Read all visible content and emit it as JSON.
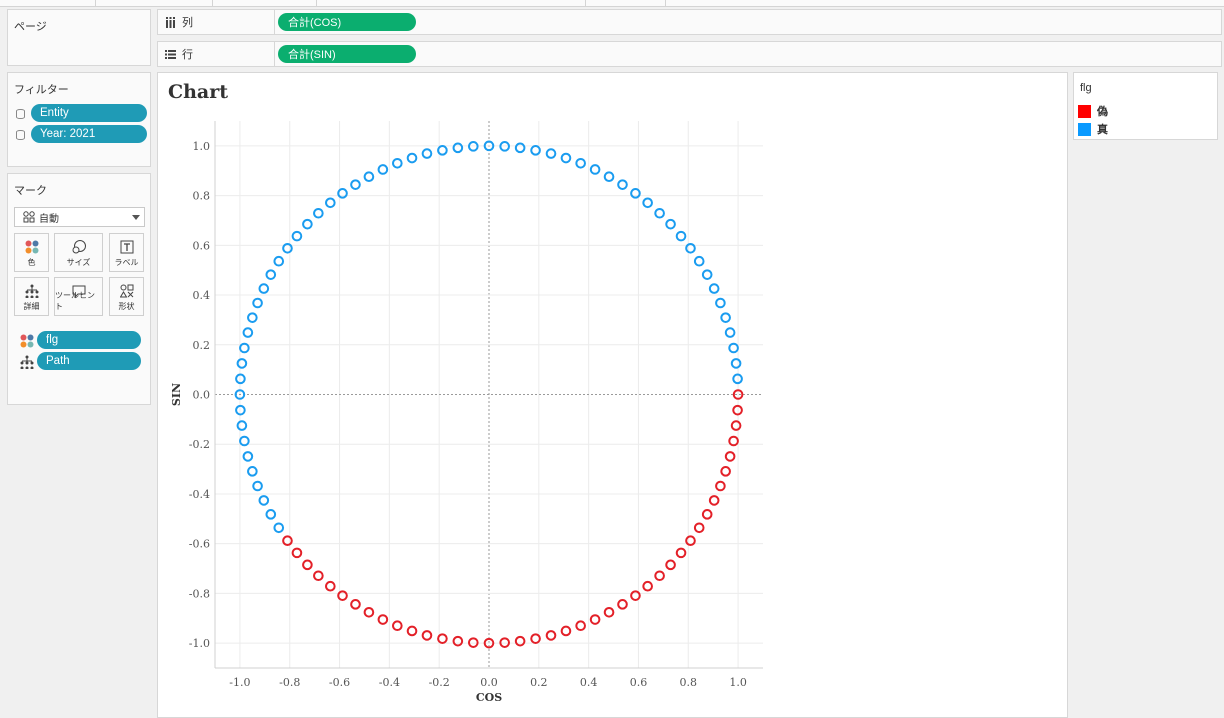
{
  "left_panel": {
    "pages_title": "ページ",
    "filters_title": "フィルター",
    "filters": [
      "Entity",
      "Year: 2021"
    ],
    "marks_title": "マーク",
    "mark_type": "自動",
    "mark_buttons": [
      "色",
      "サイズ",
      "ラベル",
      "詳細",
      "ツールヒント",
      "形状"
    ],
    "mark_fields": [
      "flg",
      "Path"
    ]
  },
  "shelves": {
    "columns_label": "列",
    "columns_pill": "合計(COS)",
    "rows_label": "行",
    "rows_pill": "合計(SIN)"
  },
  "legend": {
    "title": "flg",
    "items": [
      {
        "label": "偽",
        "color": "#ff0000"
      },
      {
        "label": "真",
        "color": "#0a9aff"
      }
    ]
  },
  "chart_data": {
    "type": "scatter",
    "title": "Chart",
    "xlabel": "COS",
    "ylabel": "SIN",
    "xlim": [
      -1.1,
      1.1
    ],
    "ylim": [
      -1.1,
      1.1
    ],
    "xticks": [
      "-1.0",
      "-0.8",
      "-0.6",
      "-0.4",
      "-0.2",
      "0.0",
      "0.2",
      "0.4",
      "0.6",
      "0.8",
      "1.0"
    ],
    "yticks": [
      "1.0",
      "0.8",
      "0.6",
      "0.4",
      "0.2",
      "0.0",
      "-0.2",
      "-0.4",
      "-0.6",
      "-0.8",
      "-1.0"
    ],
    "grid": true,
    "zero_lines": true,
    "marker": "open-circle",
    "series": [
      {
        "name": "偽",
        "color": "#e32028",
        "x": [
          1.0,
          0.998,
          0.992,
          0.982,
          0.968,
          0.95,
          0.929,
          0.904,
          0.876,
          0.844,
          0.809,
          0.771,
          0.729,
          0.685,
          0.637,
          0.588,
          0.536,
          0.482,
          0.426,
          0.368,
          0.309,
          0.249,
          0.187,
          0.125,
          0.063,
          0.0,
          -0.063,
          -0.125,
          -0.187,
          -0.249,
          -0.309,
          -0.368,
          -0.426,
          -0.482,
          -0.536,
          -0.588,
          -0.637,
          -0.685,
          -0.729,
          -0.771,
          -0.809
        ],
        "y": [
          -0.0,
          -0.063,
          -0.125,
          -0.187,
          -0.249,
          -0.309,
          -0.368,
          -0.426,
          -0.482,
          -0.536,
          -0.588,
          -0.637,
          -0.685,
          -0.729,
          -0.771,
          -0.809,
          -0.844,
          -0.876,
          -0.905,
          -0.93,
          -0.951,
          -0.969,
          -0.982,
          -0.992,
          -0.998,
          -1.0,
          -0.998,
          -0.992,
          -0.982,
          -0.969,
          -0.951,
          -0.93,
          -0.905,
          -0.876,
          -0.844,
          -0.809,
          -0.771,
          -0.729,
          -0.685,
          -0.637,
          -0.588
        ]
      },
      {
        "name": "真",
        "color": "#1a9cf0",
        "x": [
          -0.844,
          -0.876,
          -0.904,
          -0.929,
          -0.95,
          -0.968,
          -0.982,
          -0.992,
          -0.998,
          -1.0,
          -0.998,
          -0.992,
          -0.982,
          -0.968,
          -0.95,
          -0.929,
          -0.904,
          -0.876,
          -0.844,
          -0.809,
          -0.771,
          -0.729,
          -0.685,
          -0.637,
          -0.588,
          -0.536,
          -0.482,
          -0.426,
          -0.368,
          -0.309,
          -0.249,
          -0.187,
          -0.125,
          -0.063,
          0.0,
          0.063,
          0.125,
          0.187,
          0.249,
          0.309,
          0.368,
          0.426,
          0.482,
          0.536,
          0.588,
          0.637,
          0.685,
          0.729,
          0.771,
          0.809,
          0.844,
          0.876,
          0.904,
          0.929,
          0.95,
          0.968,
          0.982,
          0.992,
          0.998
        ],
        "y": [
          -0.536,
          -0.482,
          -0.426,
          -0.368,
          -0.309,
          -0.249,
          -0.187,
          -0.125,
          -0.063,
          0.0,
          0.063,
          0.125,
          0.187,
          0.249,
          0.309,
          0.368,
          0.426,
          0.482,
          0.536,
          0.588,
          0.637,
          0.685,
          0.729,
          0.771,
          0.809,
          0.844,
          0.876,
          0.905,
          0.93,
          0.951,
          0.969,
          0.982,
          0.992,
          0.998,
          1.0,
          0.998,
          0.992,
          0.982,
          0.969,
          0.951,
          0.93,
          0.905,
          0.876,
          0.844,
          0.809,
          0.771,
          0.729,
          0.685,
          0.637,
          0.588,
          0.536,
          0.482,
          0.426,
          0.368,
          0.309,
          0.249,
          0.187,
          0.125,
          0.063
        ]
      }
    ]
  }
}
